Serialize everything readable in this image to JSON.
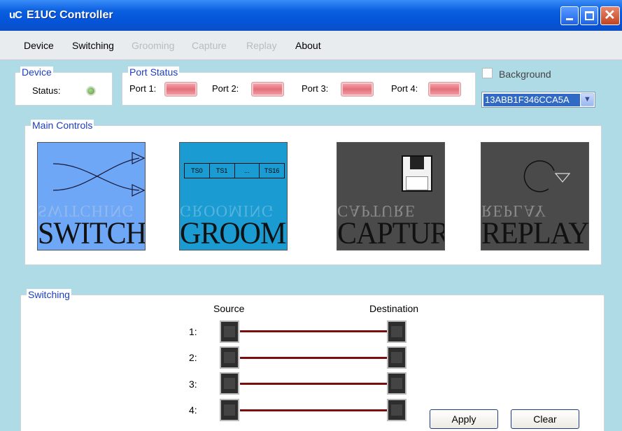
{
  "window": {
    "logo": "uC",
    "title": "E1UC Controller"
  },
  "menu": [
    "Device",
    "Switching",
    "Grooming",
    "Capture",
    "Replay",
    "About"
  ],
  "menu_disabled": [
    false,
    false,
    true,
    true,
    true,
    false
  ],
  "device": {
    "group_label": "Device",
    "status_label": "Status:"
  },
  "port_status": {
    "group_label": "Port Status",
    "ports": [
      "Port 1:",
      "Port 2:",
      "Port 3:",
      "Port 4:"
    ]
  },
  "background": {
    "label": "Background",
    "checked": false
  },
  "serial_combo": {
    "value": "13ABB1F346CCA5A"
  },
  "main_controls": {
    "group_label": "Main Controls",
    "tiles": [
      {
        "label": "SWITCHING",
        "color": "#6ea7f5"
      },
      {
        "label": "GROOMING",
        "color": "#1a9bd1",
        "slots": [
          "TS0",
          "TS1",
          "...",
          "TS16"
        ]
      },
      {
        "label": "CAPTURE",
        "color": "#4a4a4a"
      },
      {
        "label": "REPLAY",
        "color": "#4a4a4a"
      }
    ]
  },
  "switching": {
    "group_label": "Switching",
    "source_label": "Source",
    "destination_label": "Destination",
    "rows": [
      "1:",
      "2:",
      "3:",
      "4:"
    ],
    "cable_color": "#7a0d0d"
  },
  "buttons": {
    "apply": "Apply",
    "clear": "Clear"
  }
}
